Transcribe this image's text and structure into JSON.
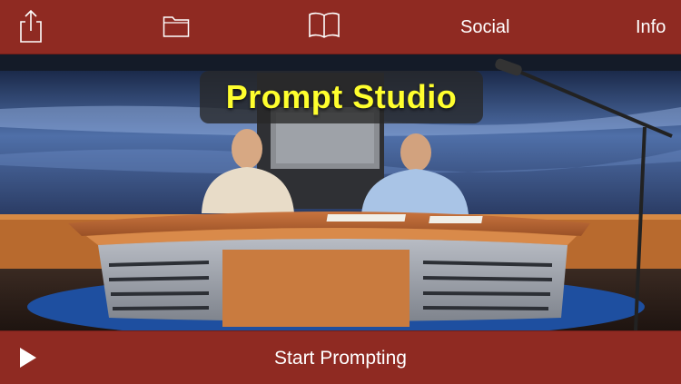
{
  "toolbar": {
    "share_icon": "share-icon",
    "folder_icon": "folder-icon",
    "book_icon": "book-icon",
    "social_label": "Social",
    "info_label": "Info"
  },
  "stage": {
    "title": "Prompt Studio"
  },
  "bottom": {
    "play_icon": "play-icon",
    "start_label": "Start Prompting"
  },
  "colors": {
    "bar": "#8f2a22",
    "title_text": "#ffff2e"
  }
}
